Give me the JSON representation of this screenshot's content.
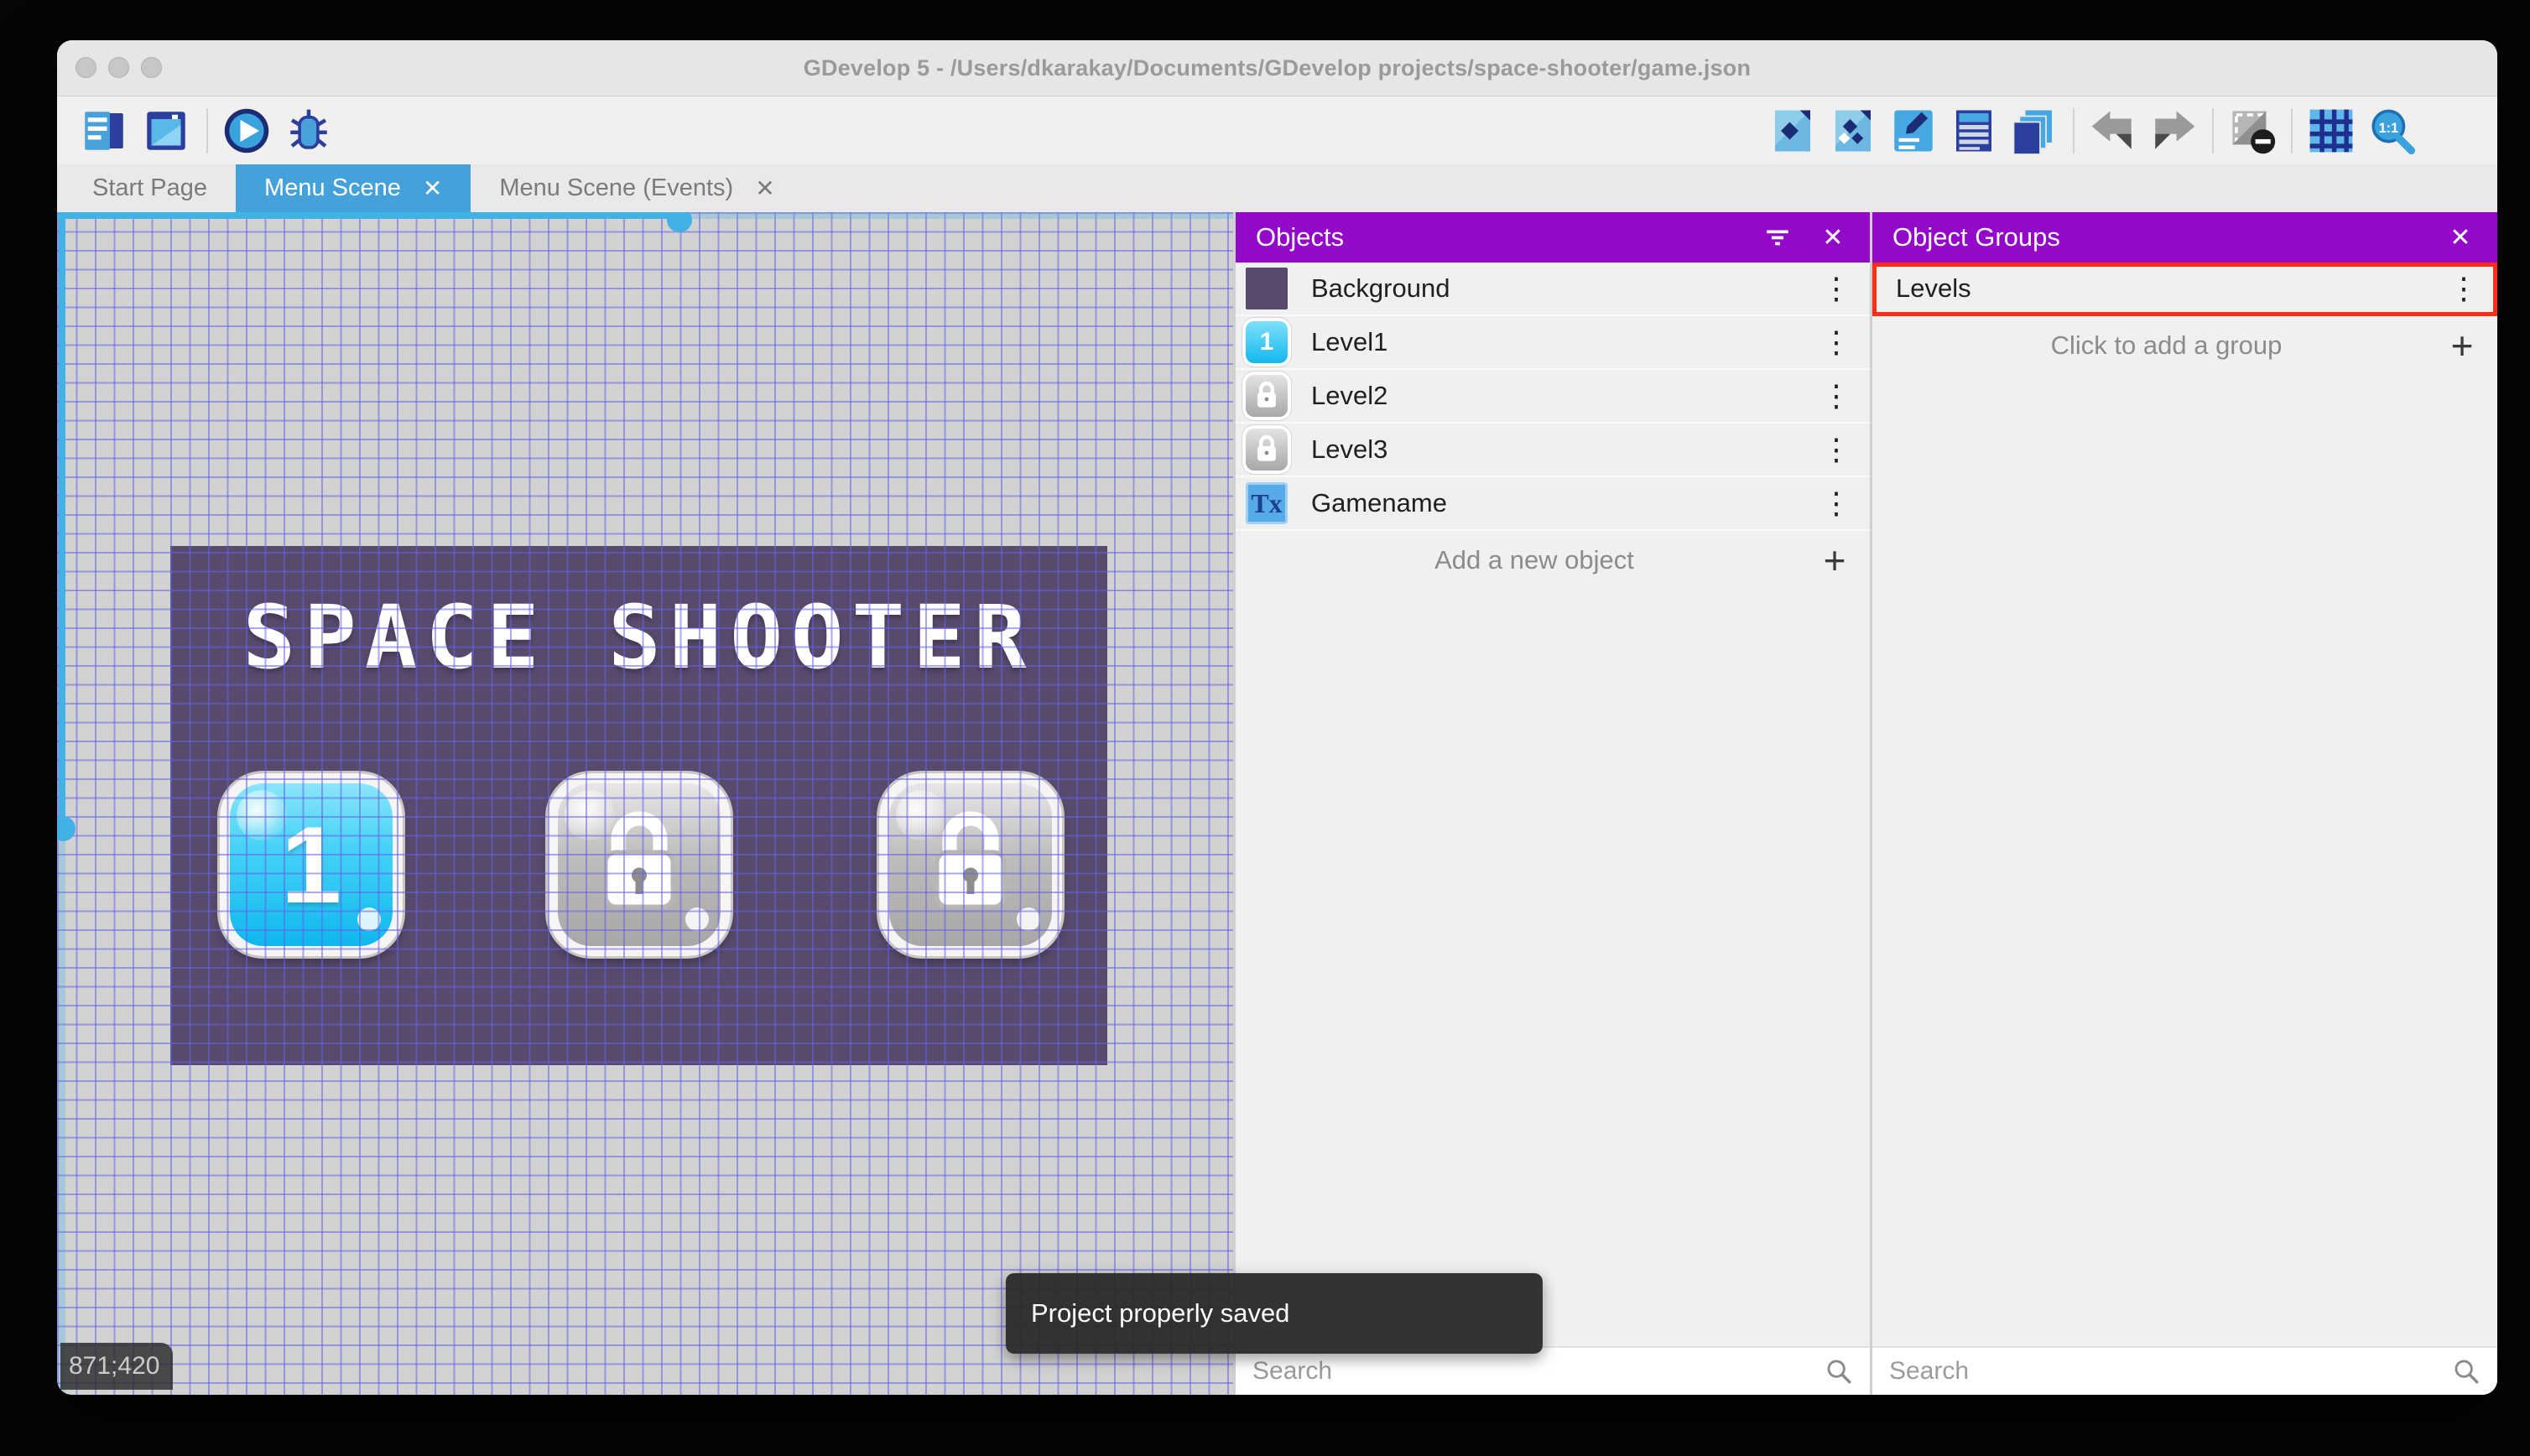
{
  "window": {
    "title": "GDevelop 5 - /Users/dkarakay/Documents/GDevelop projects/space-shooter/game.json"
  },
  "glyphs": {
    "close": "✕",
    "plus": "+",
    "kebab": "⋮"
  },
  "toolbar": {
    "left_icons": [
      "project-manager-icon",
      "scene-editor-icon",
      "play-icon",
      "debug-icon"
    ],
    "right_icons": [
      "objects-editor-icon",
      "object-groups-icon",
      "properties-icon",
      "instances-list-icon",
      "layers-icon",
      "undo-icon",
      "redo-icon",
      "mask-icon",
      "grid-icon",
      "zoom-1to1-icon"
    ],
    "zoom_icon_label": "1:1"
  },
  "tabs": [
    {
      "label": "Start Page",
      "active": false,
      "closable": false
    },
    {
      "label": "Menu Scene",
      "active": true,
      "closable": true
    },
    {
      "label": "Menu Scene (Events)",
      "active": false,
      "closable": true
    }
  ],
  "canvas": {
    "coordinates": "871;420",
    "scene": {
      "title": "SPACE SHOOTER",
      "buttons": [
        {
          "label": "1",
          "state": "unlocked"
        },
        {
          "label": "",
          "state": "locked"
        },
        {
          "label": "",
          "state": "locked"
        }
      ]
    }
  },
  "objects_panel": {
    "title": "Objects",
    "items": [
      {
        "name": "Background",
        "icon": "background-swatch"
      },
      {
        "name": "Level1",
        "icon": "level1-thumbnail"
      },
      {
        "name": "Level2",
        "icon": "locked-thumbnail"
      },
      {
        "name": "Level3",
        "icon": "locked-thumbnail"
      },
      {
        "name": "Gamename",
        "icon": "text-object",
        "icon_label": "Tx"
      }
    ],
    "add_label": "Add a new object",
    "search_placeholder": "Search"
  },
  "object_groups_panel": {
    "title": "Object Groups",
    "groups": [
      {
        "name": "Levels",
        "highlighted": true
      }
    ],
    "add_label": "Click to add a group",
    "search_placeholder": "Search"
  },
  "toast": {
    "message": "Project properly saved"
  },
  "colors": {
    "panel_header": "#9409c9",
    "active_tab": "#44a1d9",
    "highlight_border": "#ff2d16",
    "scrollbar": "#41b1e6",
    "scene_background": "#584a6c"
  }
}
